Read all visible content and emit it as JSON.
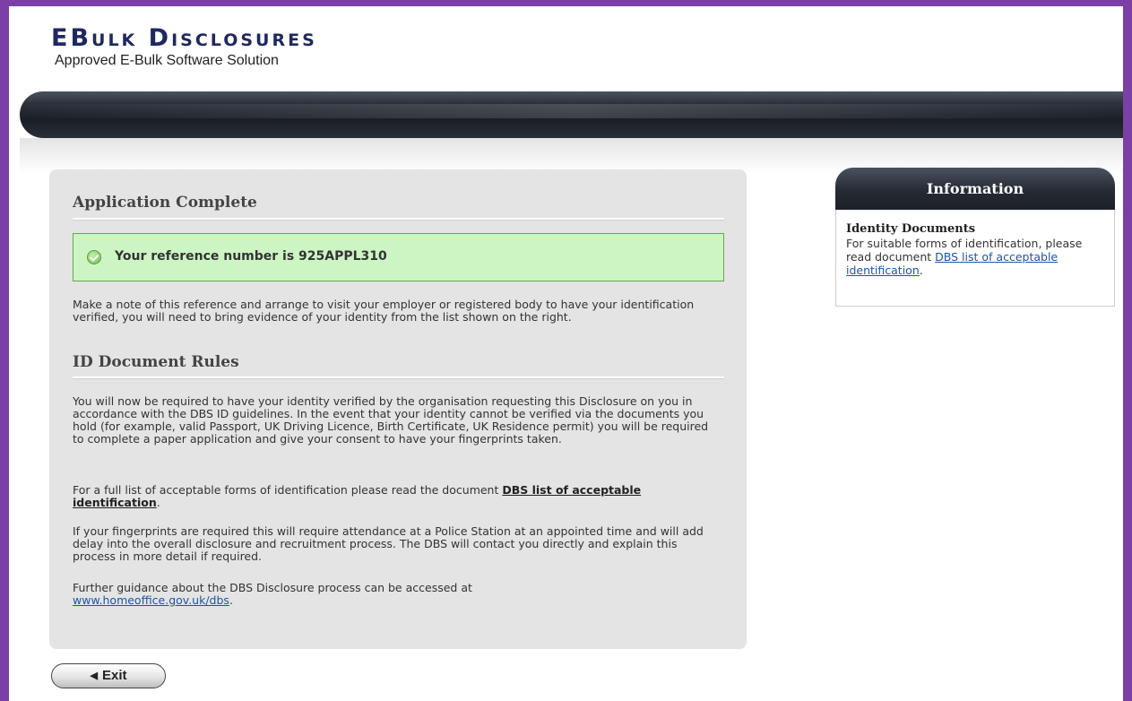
{
  "brand": {
    "title": "EBulk Disclosures",
    "subtitle": "Approved E-Bulk Software Solution"
  },
  "main": {
    "heading": "Application Complete",
    "success_message": "Your reference number is 925APPL310",
    "note": "Make a note of this reference and arrange to visit your employer or registered body to have your identification verified, you will need to bring evidence of your identity from the list shown on the right.",
    "rules_heading": "ID Document Rules",
    "rules_para1": "You will now be required to have your identity verified by the organisation requesting this Disclosure on you in accordance with the DBS ID guidelines. In the event that your identity cannot be verified via the documents you hold (for example, valid Passport, UK Driving Licence, Birth Certificate, UK Residence permit) you will be required to complete a paper application and give your consent to have your fingerprints taken.",
    "rules_para2_prefix": "For a full list of acceptable forms of identification please read the document ",
    "rules_para2_link": "DBS list of acceptable identification",
    "rules_para2_suffix": ".",
    "rules_para3": "If your fingerprints are required this will require attendance at a Police Station at an appointed time and will add delay into the overall disclosure and recruitment process. The DBS will contact you directly and explain this process in more detail if required.",
    "rules_para4_prefix": "Further guidance about the DBS Disclosure process can be accessed at",
    "rules_para4_link": "www.homeoffice.gov.uk/dbs",
    "rules_para4_suffix": "."
  },
  "sidebar": {
    "header": "Information",
    "title": "Identity Documents",
    "text_prefix": "For suitable forms of identification, please read document ",
    "link": "DBS list of acceptable identification",
    "text_suffix": "."
  },
  "footer": {
    "exit_label": "Exit"
  },
  "colors": {
    "frame": "#7b3fa6",
    "success_bg": "#cdf5c4",
    "link": "#1a56a8"
  }
}
